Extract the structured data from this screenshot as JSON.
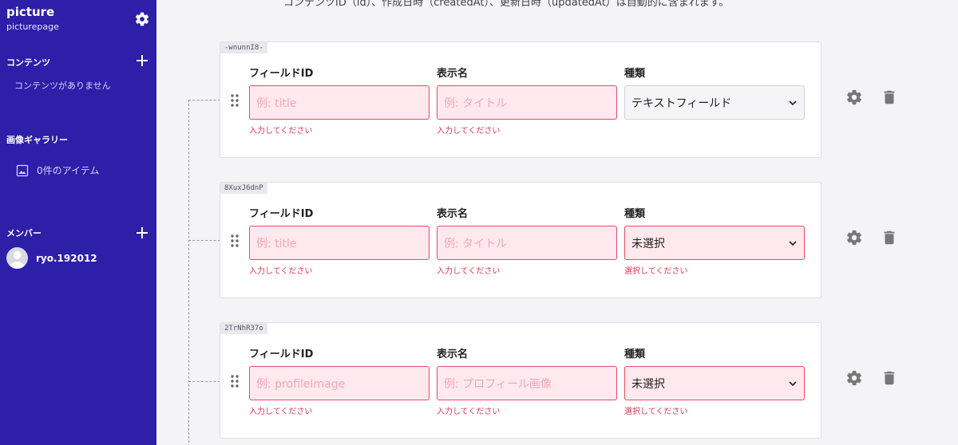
{
  "sidebar": {
    "service_name": "picture",
    "service_id": "picturepage",
    "contents_title": "コンテンツ",
    "contents_empty": "コンテンツがありません",
    "gallery_title": "画像ギャラリー",
    "gallery_item": "0件のアイテム",
    "members_title": "メンバー",
    "member_name": "ryo.192012"
  },
  "main": {
    "top_note": "コンテンツID（id）、作成日時（createdAt）、更新日時（updatedAt）は自動的に含まれます。"
  },
  "labels": {
    "field_id": "フィールドID",
    "display_name": "表示名",
    "type": "種類"
  },
  "fields": [
    {
      "key": "-wnunnI8-",
      "id_placeholder": "例: title",
      "name_placeholder": "例: タイトル",
      "type_value": "テキストフィールド",
      "id_error": "入力してください",
      "name_error": "入力してください",
      "type_error": ""
    },
    {
      "key": "8XuxJ6dnP",
      "id_placeholder": "例: title",
      "name_placeholder": "例: タイトル",
      "type_value": "未選択",
      "id_error": "入力してください",
      "name_error": "入力してください",
      "type_error": "選択してください"
    },
    {
      "key": "2TrNhR37o",
      "id_placeholder": "例: profileImage",
      "name_placeholder": "例: プロフィール画像",
      "type_value": "未選択",
      "id_error": "入力してください",
      "name_error": "入力してください",
      "type_error": "選択してください"
    }
  ],
  "icons": {
    "settings": "gear-icon",
    "delete": "trash-icon",
    "add": "plus-icon",
    "drag": "grip-icon",
    "image": "image-icon",
    "dropdown": "chevron-down-icon"
  },
  "colors": {
    "sidebar_bg": "#2d1fa8",
    "error": "#e33355",
    "error_field_bg": "#ffe8ee"
  }
}
